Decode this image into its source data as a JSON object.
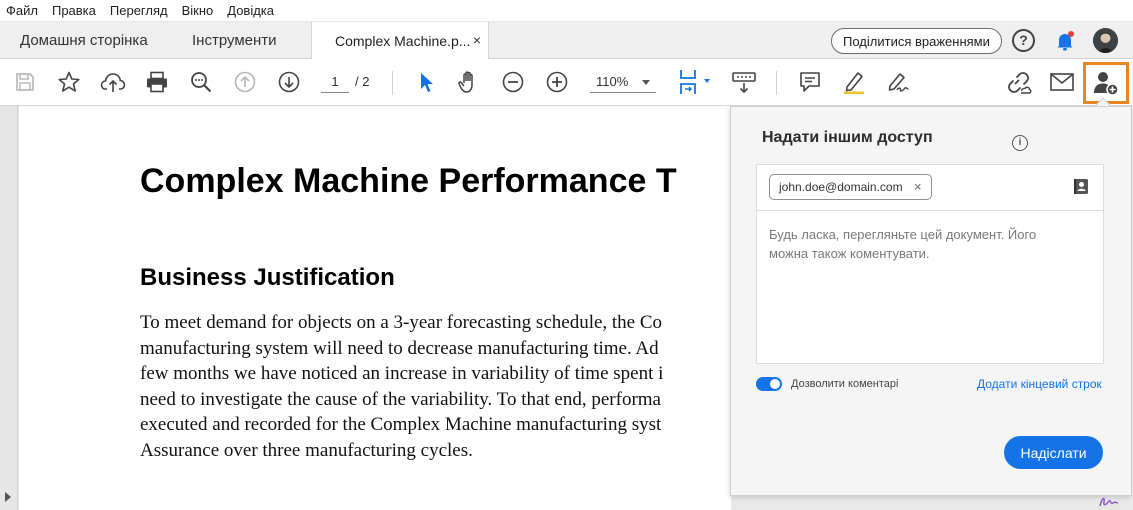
{
  "menu": {
    "items": [
      "Файл",
      "Правка",
      "Перегляд",
      "Вікно",
      "Довідка"
    ]
  },
  "tabs": {
    "home": "Домашня сторінка",
    "tools": "Інструменти",
    "document": "Complex Machine.p...",
    "document_close": "×"
  },
  "header": {
    "share_feedback": "Поділитися враженнями",
    "help": "?"
  },
  "toolbar": {
    "page_current": "1",
    "page_total": "/ 2",
    "zoom": "110%"
  },
  "document": {
    "title": "Complex Machine Performance T",
    "heading": "Business Justification",
    "paragraph_lines": [
      "To meet demand for objects on a 3-year forecasting schedule, the Co",
      "manufacturing system will need to decrease manufacturing time. Ad",
      "few months we have noticed an increase in variability of time spent i",
      "need to investigate the cause of the variability. To that end, performa",
      "executed and recorded for the Complex Machine manufacturing syst",
      "Assurance over three manufacturing cycles."
    ]
  },
  "share_panel": {
    "title": "Надати іншим доступ",
    "info": "i",
    "recipient": "john.doe@domain.com",
    "remove": "×",
    "message_line1": "Будь ласка, перегляньте цей документ. Його",
    "message_line2": "можна також коментувати.",
    "allow_comments": "Дозволити коментарі",
    "allow_comments_on": true,
    "add_deadline": "Додати кінцевий строк",
    "send": "Надіслати"
  },
  "colors": {
    "accent": "#1473e6",
    "share_highlight": "#e8861f",
    "notification": "#e0433a"
  }
}
